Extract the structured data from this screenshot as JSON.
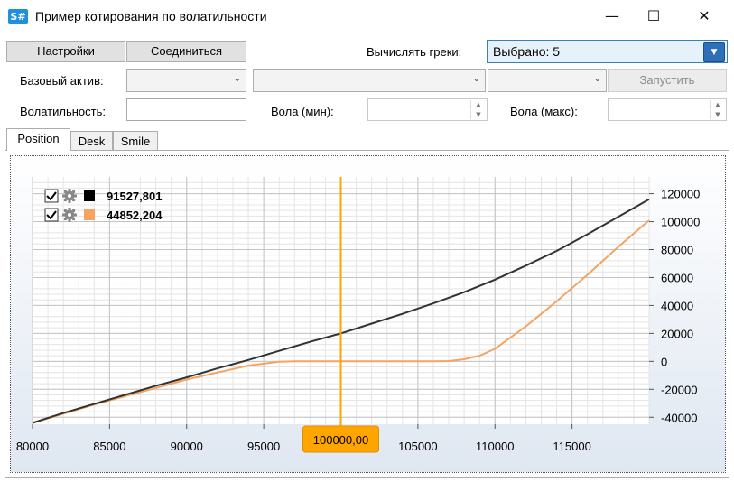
{
  "window": {
    "app_icon_text": "S#",
    "title": "Пример котирования по волатильности",
    "minimize_glyph": "—",
    "maximize_glyph": "☐",
    "close_glyph": "✕"
  },
  "toolbar": {
    "settings_label": "Настройки",
    "connect_label": "Соединиться",
    "greeks_label": "Вычислять греки:",
    "greeks_value": "Выбрано: 5",
    "underlying_label": "Базовый актив:",
    "underlying_value": "",
    "combo2_value": "",
    "combo3_value": "",
    "run_label": "Запустить",
    "volatility_label": "Волатильность:",
    "volatility_value": "",
    "vol_min_label": "Вола (мин):",
    "vol_min_value": "",
    "vol_max_label": "Вола (макс):",
    "vol_max_value": ""
  },
  "tabs": [
    {
      "label": "Position",
      "active": true
    },
    {
      "label": "Desk",
      "active": false
    },
    {
      "label": "Smile",
      "active": false
    }
  ],
  "legend": [
    {
      "value": "91527,801",
      "color": "#000000",
      "checked": true,
      "icon": "gear-icon"
    },
    {
      "value": "44852,204",
      "color": "#f4a460",
      "checked": true,
      "icon": "gear-icon"
    }
  ],
  "cursor": {
    "x": 100000,
    "label": "100000,00",
    "color": "#ffa500"
  },
  "chart_data": {
    "type": "line",
    "x_ticks": [
      "80000",
      "85000",
      "90000",
      "95000",
      "100000,00",
      "105000",
      "110000",
      "115000"
    ],
    "y_ticks": [
      "120000",
      "100000",
      "80000",
      "60000",
      "40000",
      "20000",
      "0",
      "-20000",
      "-40000"
    ],
    "xlim": [
      80000,
      120000
    ],
    "ylim": [
      -45000,
      132000
    ],
    "y_axis_side": "right",
    "grid": true,
    "legend_position": "top-left",
    "series": [
      {
        "color": "#333333",
        "x": [
          80000,
          82000,
          84000,
          86000,
          88000,
          90000,
          92000,
          94000,
          96000,
          98000,
          100000,
          102000,
          104000,
          106000,
          108000,
          110000,
          112000,
          114000,
          116000,
          118000,
          120000
        ],
        "y": [
          -44000,
          -37000,
          -30500,
          -24000,
          -17500,
          -11500,
          -5000,
          1000,
          7500,
          14000,
          20000,
          27000,
          34000,
          41500,
          49500,
          58500,
          68500,
          79000,
          91000,
          103500,
          116000
        ]
      },
      {
        "color": "#f4a460",
        "x": [
          80000,
          82000,
          84000,
          86000,
          88000,
          90000,
          92000,
          94000,
          96000,
          97000,
          98000,
          100000,
          102000,
          104000,
          106000,
          107000,
          108000,
          109000,
          110000,
          112000,
          114000,
          116000,
          118000,
          120000
        ],
        "y": [
          -44000,
          -37500,
          -31000,
          -25000,
          -19000,
          -13000,
          -8000,
          -3000,
          -300,
          0,
          0,
          0,
          0,
          0,
          0,
          200,
          1500,
          4000,
          9000,
          25000,
          43000,
          62000,
          82000,
          101000
        ]
      }
    ]
  }
}
